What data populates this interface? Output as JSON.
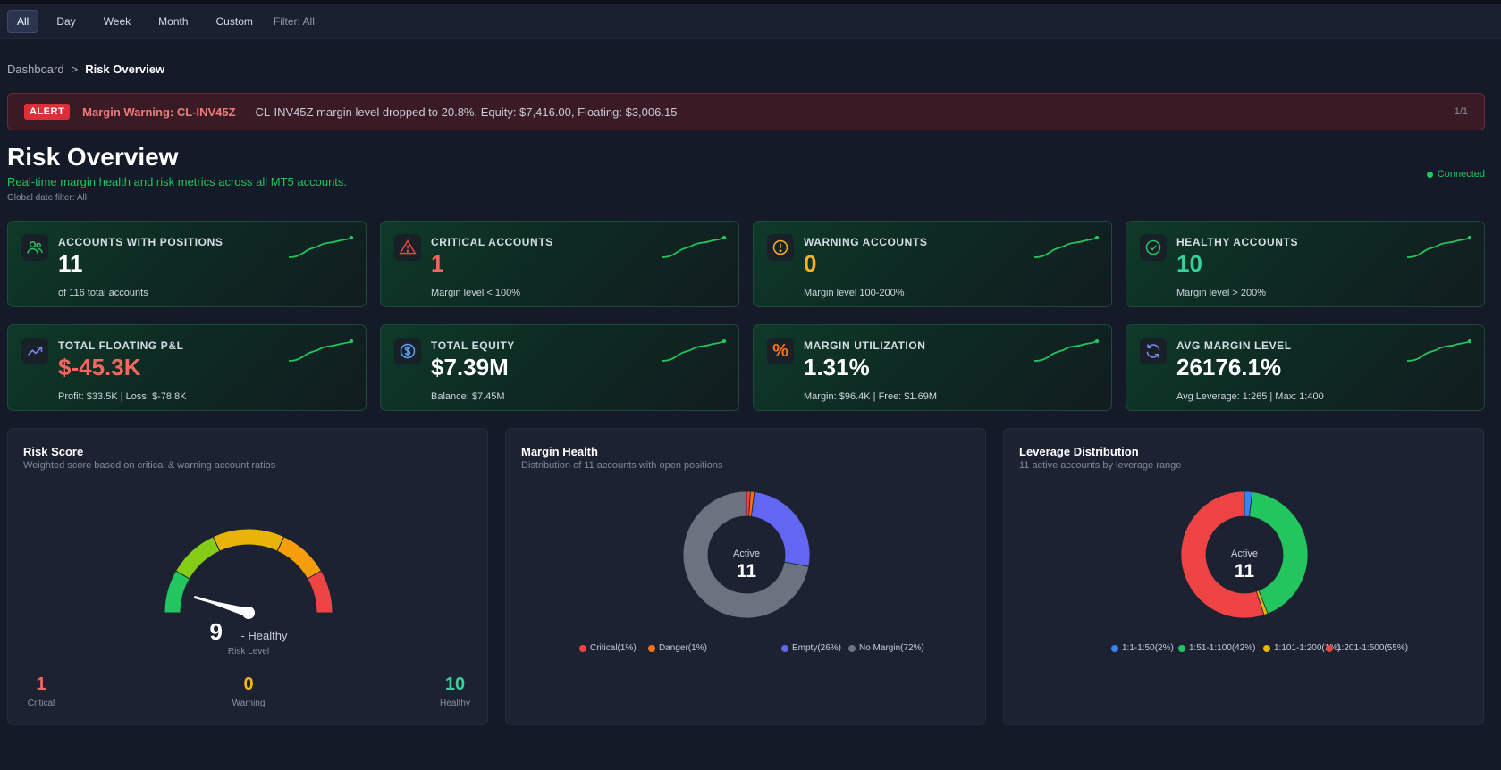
{
  "filter_bar": {
    "buttons": [
      "All",
      "Day",
      "Week",
      "Month",
      "Custom"
    ],
    "active": "All",
    "filter_label": "Filter: All"
  },
  "breadcrumb": {
    "root": "Dashboard",
    "separator": ">",
    "current": "Risk Overview"
  },
  "alert": {
    "badge": "ALERT",
    "title": "Margin Warning: CL-INV45Z",
    "message": "- CL-INV45Z margin level dropped to 20.8%, Equity: $7,416.00, Floating: $3,006.15",
    "count": "1/1"
  },
  "header": {
    "title": "Risk Overview",
    "subtitle": "Real-time margin health and risk metrics across all MT5 accounts.",
    "date_filter": "Global date filter: All",
    "status": "Connected"
  },
  "cards": [
    {
      "label": "Accounts with Positions",
      "value": "11",
      "sub": "of 116 total accounts",
      "icon": "users-icon",
      "value_color": "#ffffff"
    },
    {
      "label": "Critical Accounts",
      "value": "1",
      "sub": "Margin level < 100%",
      "icon": "alert-triangle-icon",
      "value_color": "#f2675f"
    },
    {
      "label": "Warning Accounts",
      "value": "0",
      "sub": "Margin level 100-200%",
      "icon": "alert-circle-icon",
      "value_color": "#f5b21f"
    },
    {
      "label": "Healthy Accounts",
      "value": "10",
      "sub": "Margin level > 200%",
      "icon": "check-circle-icon",
      "value_color": "#34d399"
    },
    {
      "label": "Total Floating P&L",
      "value": "$-45.3K",
      "sub": "Profit: $33.5K | Loss: $-78.8K",
      "icon": "trending-up-icon",
      "value_color": "#f2675f"
    },
    {
      "label": "Total Equity",
      "value": "$7.39M",
      "sub": "Balance: $7.45M",
      "icon": "dollar-icon",
      "value_color": "#ffffff"
    },
    {
      "label": "Margin Utilization",
      "value": "1.31%",
      "sub": "Margin: $96.4K | Free: $1.69M",
      "icon": "percent-icon",
      "value_color": "#ffffff"
    },
    {
      "label": "Avg Margin Level",
      "value": "26176.1%",
      "sub": "Avg Leverage: 1:265 | Max: 1:400",
      "icon": "refresh-icon",
      "value_color": "#ffffff"
    }
  ],
  "risk_score": {
    "title": "Risk Score",
    "subtitle": "Weighted score based on critical & warning account ratios",
    "score": "9",
    "status": "- Healthy",
    "level_label": "Risk Level",
    "score_value": 9,
    "stats": [
      {
        "value": "1",
        "label": "Critical",
        "color": "#f2675f"
      },
      {
        "value": "0",
        "label": "Warning",
        "color": "#f5b21f"
      },
      {
        "value": "10",
        "label": "Healthy",
        "color": "#34d399"
      }
    ]
  },
  "margin_health": {
    "title": "Margin Health",
    "subtitle": "Distribution of 11 accounts with open positions",
    "center_label": "Active",
    "center_value": "11",
    "legend": [
      {
        "label": "Critical(1%)",
        "color": "#ef4444"
      },
      {
        "label": "Danger(1%)",
        "color": "#f97316"
      },
      {
        "label": "Empty(26%)",
        "color": "#6366f1"
      },
      {
        "label": "No Margin(72%)",
        "color": "#6b7280"
      }
    ]
  },
  "leverage_distribution": {
    "title": "Leverage Distribution",
    "subtitle": "11 active accounts by leverage range",
    "center_label": "Active",
    "center_value": "11",
    "legend": [
      {
        "label": "1:1-1:50(2%)",
        "color": "#3b82f6"
      },
      {
        "label": "1:51-1:100(42%)",
        "color": "#22c55e"
      },
      {
        "label": "1:101-1:200(1%)",
        "color": "#eab308"
      },
      {
        "label": "1:201-1:500(55%)",
        "color": "#ef4444"
      }
    ]
  },
  "chart_data": [
    {
      "type": "pie",
      "title": "Margin Health",
      "categories": [
        "Critical",
        "Danger",
        "Empty",
        "No Margin"
      ],
      "values": [
        1,
        1,
        26,
        72
      ],
      "colors": [
        "#ef4444",
        "#f97316",
        "#6366f1",
        "#6b7280"
      ]
    },
    {
      "type": "pie",
      "title": "Leverage Distribution",
      "categories": [
        "1:1-1:50",
        "1:51-1:100",
        "1:101-1:200",
        "1:201-1:500"
      ],
      "values": [
        2,
        42,
        1,
        55
      ],
      "colors": [
        "#3b82f6",
        "#22c55e",
        "#eab308",
        "#ef4444"
      ]
    }
  ]
}
